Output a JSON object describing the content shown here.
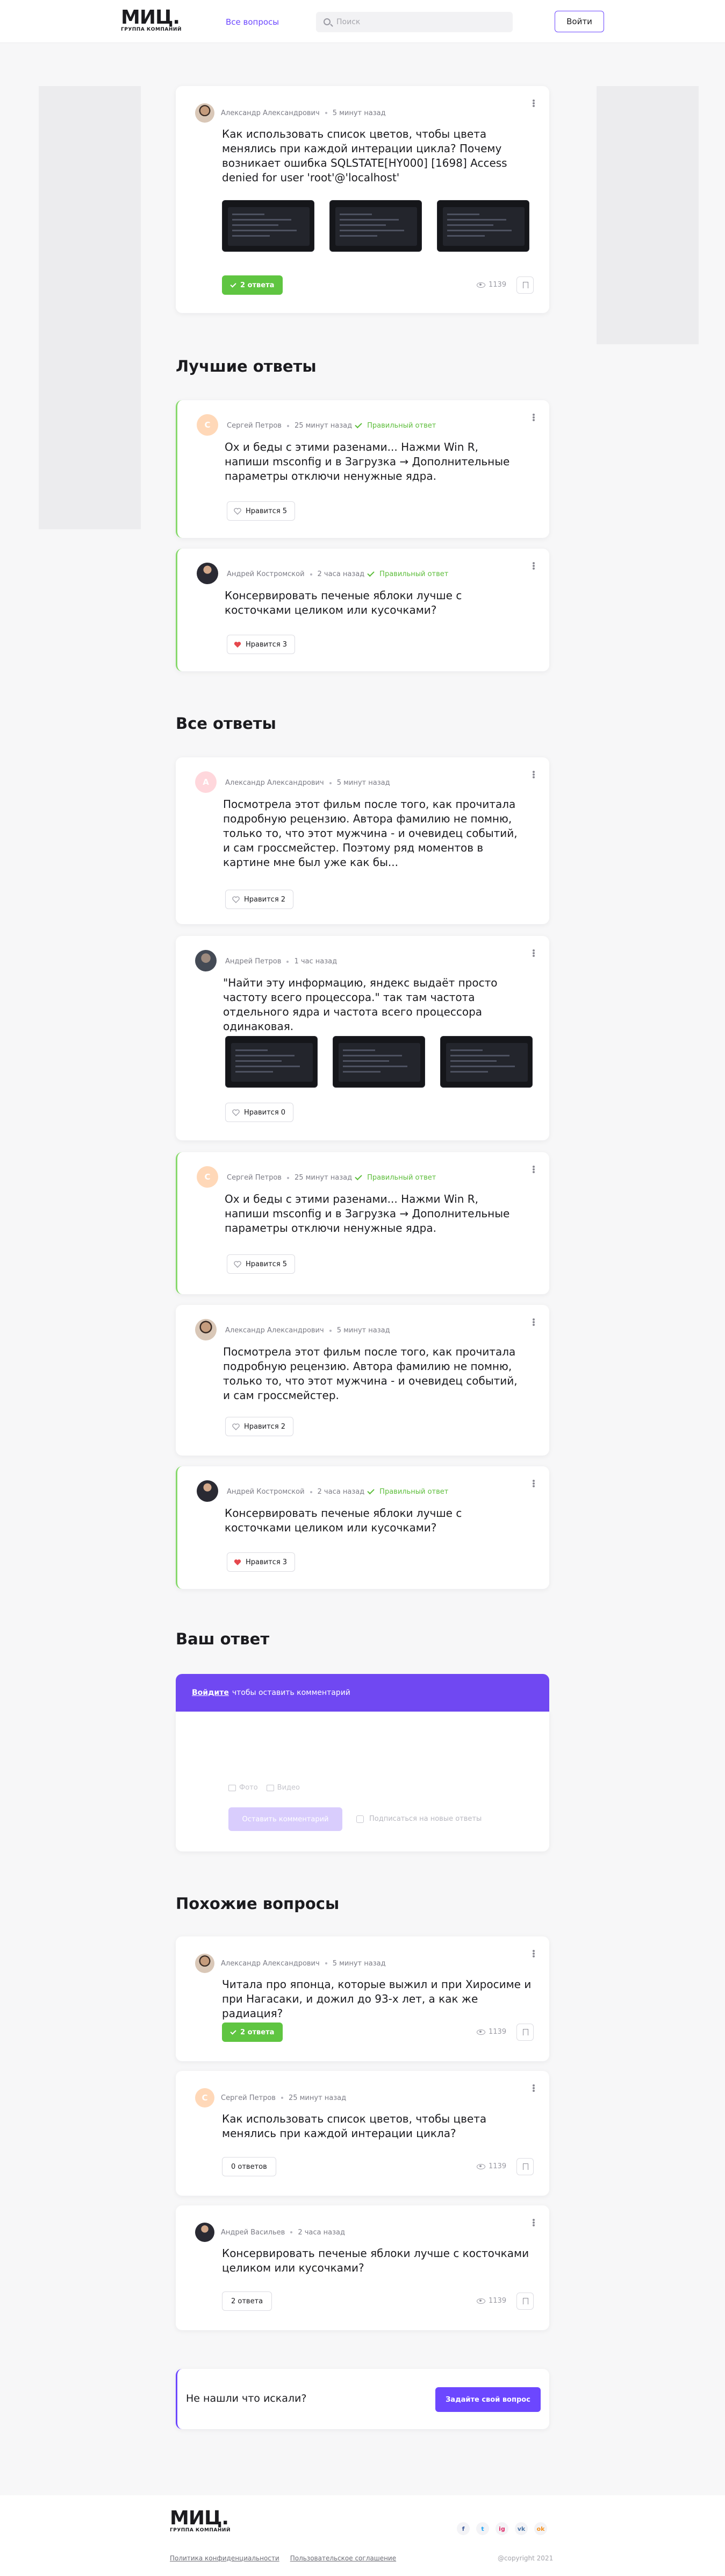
{
  "header": {
    "logo": "МИЦ.",
    "logo_sub": "ГРУППА КОМПАНИЙ",
    "nav_all_questions": "Все вопросы",
    "search_placeholder": "Поиск",
    "login_label": "Войти"
  },
  "question": {
    "author": "Александр Александрович",
    "time": "5 минут назад",
    "text": "Как использовать список цветов, чтобы цвета менялись при каждой интерации цикла? Почему возникает ошибка SQLSTATE[HY000] [1698] Access denied for user 'root'@'localhost'",
    "answers_label": "2 ответа",
    "views": "1139"
  },
  "best_answers_title": "Лучшие ответы",
  "best_answers": [
    {
      "author": "Сергей Петров",
      "time": "25 минут назад",
      "correct": "Правильный ответ",
      "text": "Ох и беды с этими разенами... Нажми Win R, напиши msconfig и в Загрузка → Дополнительные параметры отключи ненужные ядра.",
      "likes": "Нравится 5"
    },
    {
      "author": "Андрей Костромской",
      "time": "2 часа назад",
      "correct": "Правильный ответ",
      "text": "Консервировать печеные яблоки лучше с косточками целиком или кусочками?",
      "likes": "Нравится 3"
    }
  ],
  "all_answers_title": "Все ответы",
  "all_answers": [
    {
      "author": "Александр Александрович",
      "time": "5 минут назад",
      "avatar_letter": "А",
      "text": "Посмотрела этот фильм после того, как прочитала подробную рецензию. Автора фамилию не помню, только то, что этот мужчина - и очевидец событий, и сам гроссмейстер. Поэтому ряд моментов в картине мне был уже как бы...",
      "likes": "Нравится 2"
    },
    {
      "author": "Андрей Петров",
      "time": "1 час назад",
      "text": "\"Найти эту информацию, яндекс выдаёт просто частоту всего процессора.\" так там частота отдельного ядра и частота всего процессора одинаковая.",
      "likes": "Нравится 0"
    },
    {
      "author": "Сергей Петров",
      "time": "25 минут назад",
      "avatar_letter": "С",
      "correct": "Правильный ответ",
      "text": "Ох и беды с этими разенами... Нажми Win R, напиши msconfig и в Загрузка → Дополнительные параметры отключи ненужные ядра.",
      "likes": "Нравится 5"
    },
    {
      "author": "Александр Александрович",
      "time": "5 минут назад",
      "text": "Посмотрела этот фильм после того, как прочитала подробную рецензию. Автора фамилию не помню, только то, что этот мужчина - и очевидец событий, и сам гроссмейстер.",
      "likes": "Нравится 2"
    },
    {
      "author": "Андрей Костромской",
      "time": "2 часа назад",
      "correct": "Правильный ответ",
      "text": "Консервировать печеные яблоки лучше с косточками целиком или кусочками?",
      "likes": "Нравится 3"
    }
  ],
  "your_answer": {
    "title": "Ваш ответ",
    "login_link": "Войдите",
    "login_rest": "чтобы оставить комментарий",
    "photo": "Фото",
    "video": "Видео",
    "send": "Оставить комментарий",
    "subscribe": "Подписаться на новые ответы"
  },
  "similar_title": "Похожие вопросы",
  "similar": [
    {
      "author": "Александр Александрович",
      "time": "5 минут назад",
      "text": "Читала про японца, которые выжил и при Хиросиме и при Нагасаки, и дожил до 93-х лет, а как же радиация?",
      "answers": "2 ответа",
      "views": "1139"
    },
    {
      "author": "Сергей Петров",
      "time": "25 минут назад",
      "avatar_letter": "С",
      "text": "Как использовать список цветов, чтобы цвета менялись при каждой интерации цикла?",
      "answers": "0 ответов",
      "views": "1139"
    },
    {
      "author": "Андрей Васильев",
      "time": "2 часа назад",
      "text": "Консервировать печеные яблоки лучше с косточками целиком или кусочками?",
      "answers": "2 ответа",
      "views": "1139"
    }
  ],
  "not_found": {
    "text": "Не нашли что искали?",
    "button": "Задайте свой вопрос"
  },
  "footer": {
    "logo": "МИЦ.",
    "logo_sub": "ГРУППА КОМПАНИЙ",
    "privacy": "Политика конфиденциальности",
    "agreement": "Пользовательское соглашение",
    "copyright": "@copyright 2021",
    "socials": [
      "f",
      "t",
      "ig",
      "vk",
      "ok"
    ]
  },
  "colors": {
    "accent": "#6c47ff",
    "success": "#5fc541",
    "heart": "#e5484d"
  }
}
